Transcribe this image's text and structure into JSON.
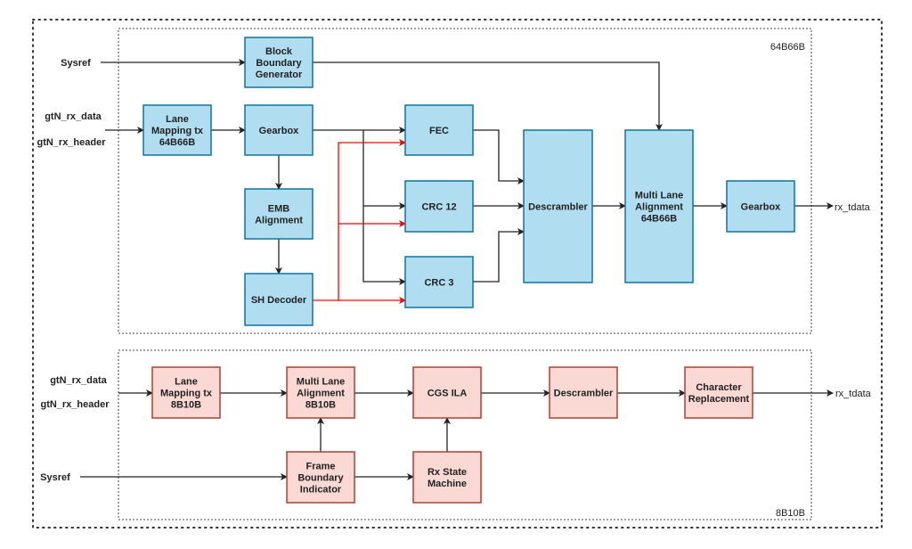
{
  "colors": {
    "blue_fill": "#b1ddf0",
    "blue_stroke": "#10739e",
    "pink_fill": "#fad9d5",
    "pink_stroke": "#ae4132",
    "line": "#222222",
    "red_line": "#ff0000"
  },
  "top_section": {
    "label": "64B66B",
    "signals": {
      "sysref": "Sysref",
      "rx_data": "gtN_rx_data",
      "rx_header": "gtN_rx_header",
      "out": "rx_tdata"
    },
    "blocks": {
      "block_boundary_generator": [
        "Block",
        "Boundary",
        "Generator"
      ],
      "lane_mapping": [
        "Lane",
        "Mapping tx",
        "64B66B"
      ],
      "gearbox_in": [
        "Gearbox"
      ],
      "emb_alignment": [
        "EMB",
        "Alignment"
      ],
      "sh_decoder": [
        "SH Decoder"
      ],
      "fec": [
        "FEC"
      ],
      "crc12": [
        "CRC 12"
      ],
      "crc3": [
        "CRC 3"
      ],
      "descrambler": [
        "Descrambler"
      ],
      "multi_lane_alignment": [
        "Multi Lane",
        "Alignment",
        "64B66B"
      ],
      "gearbox_out": [
        "Gearbox"
      ]
    }
  },
  "bottom_section": {
    "label": "8B10B",
    "signals": {
      "sysref": "Sysref",
      "rx_data": "gtN_rx_data",
      "rx_header": "gtN_rx_header",
      "out": "rx_tdata"
    },
    "blocks": {
      "lane_mapping": [
        "Lane",
        "Mapping tx",
        "8B10B"
      ],
      "multi_lane_alignment": [
        "Multi Lane",
        "Alignment",
        "8B10B"
      ],
      "cgs_ila": [
        "CGS ILA"
      ],
      "descrambler": [
        "Descrambler"
      ],
      "character_replacement": [
        "Character",
        "Replacement"
      ],
      "frame_boundary_indicator": [
        "Frame",
        "Boundary",
        "Indicator"
      ],
      "rx_state_machine": [
        "Rx State",
        "Machine"
      ]
    }
  }
}
